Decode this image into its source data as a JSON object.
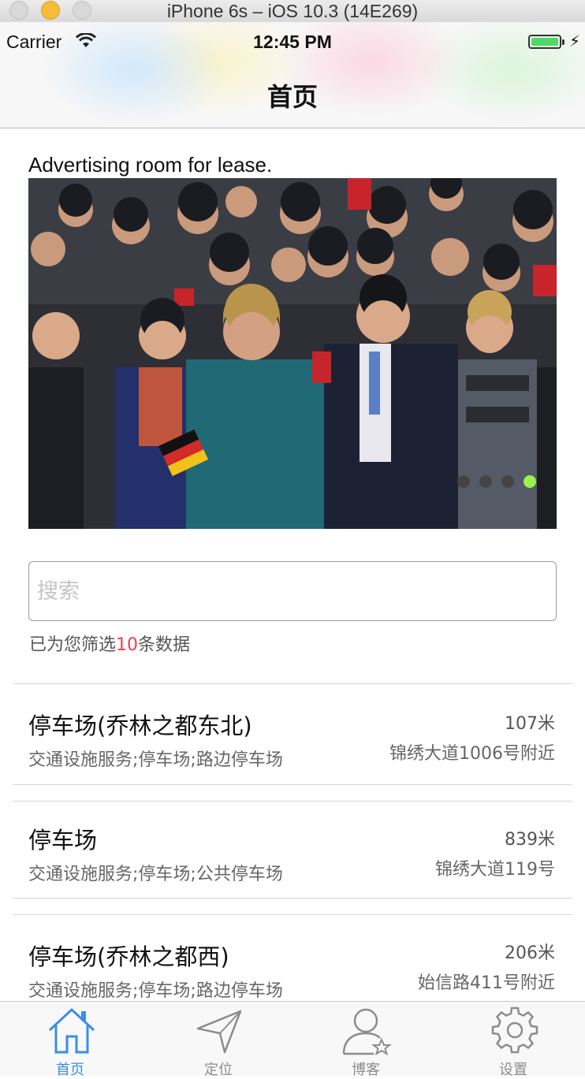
{
  "simulator": {
    "title": "iPhone 6s – iOS 10.3 (14E269)"
  },
  "status_bar": {
    "carrier": "Carrier",
    "time": "12:45 PM"
  },
  "nav": {
    "title": "首页"
  },
  "ad": {
    "text": "Advertising room for lease."
  },
  "banner": {
    "page_count": 4,
    "active_page": 4
  },
  "search": {
    "placeholder": "搜索",
    "value": ""
  },
  "filter": {
    "prefix": "已为您筛选",
    "count": "10",
    "suffix": "条数据"
  },
  "results": [
    {
      "name": "停车场(乔林之都东北)",
      "type": "交通设施服务;停车场;路边停车场",
      "distance": "107米",
      "address": "锦绣大道1006号附近"
    },
    {
      "name": "停车场",
      "type": "交通设施服务;停车场;公共停车场",
      "distance": "839米",
      "address": "锦绣大道119号"
    },
    {
      "name": "停车场(乔林之都西)",
      "type": "交通设施服务;停车场;路边停车场",
      "distance": "206米",
      "address": "始信路411号附近"
    }
  ],
  "tabs": [
    {
      "label": "首页",
      "icon": "home-icon",
      "active": true
    },
    {
      "label": "定位",
      "icon": "location-arrow-icon",
      "active": false
    },
    {
      "label": "博客",
      "icon": "user-star-icon",
      "active": false
    },
    {
      "label": "设置",
      "icon": "gear-icon",
      "active": false
    }
  ],
  "colors": {
    "accent": "#3a8ee6",
    "count_highlight": "#e8424e",
    "active_dot": "#9af24a",
    "battery": "#4cd964"
  }
}
